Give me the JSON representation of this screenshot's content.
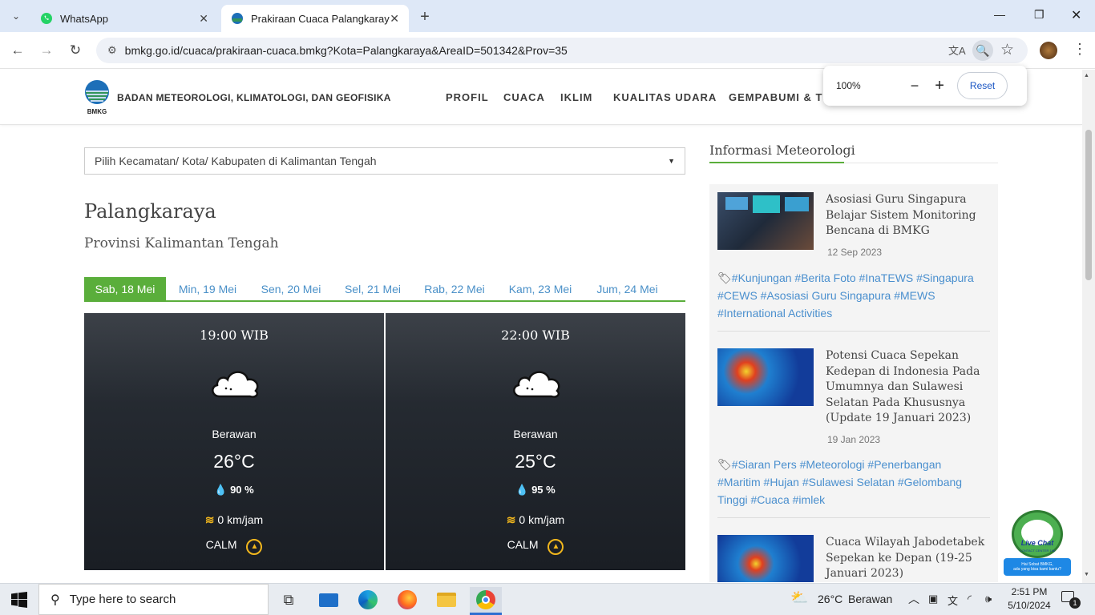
{
  "browser": {
    "tabs": [
      {
        "label": "WhatsApp"
      },
      {
        "label": "Prakiraan Cuaca Palangkaraya -"
      }
    ],
    "new_tab": "+",
    "url": "bmkg.go.id/cuaca/prakiraan-cuaca.bmkg?Kota=Palangkaraya&AreaID=501342&Prov=35",
    "zoom": {
      "level": "100%",
      "reset_label": "Reset",
      "minus": "−",
      "plus": "+"
    }
  },
  "site": {
    "logo_text": "BMKG",
    "org_name": "BADAN METEOROLOGI, KLIMATOLOGI, DAN GEOFISIKA",
    "nav": [
      "PROFIL",
      "CUACA",
      "IKLIM",
      "KUALITAS UDARA",
      "GEMPABUMI & TS"
    ]
  },
  "location_select": {
    "placeholder": "Pilih Kecamatan/ Kota/ Kabupaten di Kalimantan Tengah"
  },
  "city": "Palangkaraya",
  "province": "Provinsi Kalimantan Tengah",
  "days": [
    "Sab, 18 Mei",
    "Min, 19 Mei",
    "Sen, 20 Mei",
    "Sel, 21 Mei",
    "Rab, 22 Mei",
    "Kam, 23 Mei",
    "Jum, 24 Mei"
  ],
  "forecasts": [
    {
      "time": "19:00 WIB",
      "condition": "Berawan",
      "temp": "26°C",
      "humidity": "90 %",
      "wind": "0 km/jam",
      "direction": "CALM"
    },
    {
      "time": "22:00 WIB",
      "condition": "Berawan",
      "temp": "25°C",
      "humidity": "95 %",
      "wind": "0 km/jam",
      "direction": "CALM"
    }
  ],
  "sidebar": {
    "heading": "Informasi Meteorologi",
    "articles": [
      {
        "title_lines": [
          "Asosiasi Guru Singapura",
          "Belajar Sistem Monitoring",
          "Bencana di BMKG"
        ],
        "date": "12 Sep 2023",
        "tag_lines": [
          "#Kunjungan #Berita Foto #InaTEWS #Singapura",
          "#CEWS #Asosiasi Guru Singapura #MEWS",
          "#International Activities"
        ]
      },
      {
        "title_lines": [
          "Potensi Cuaca Sepekan",
          "Kedepan di Indonesia Pada",
          "Umumnya dan Sulawesi",
          "Selatan Pada Khususnya",
          "(Update 19 Januari 2023)"
        ],
        "date": "19 Jan 2023",
        "tag_lines": [
          "#Siaran Pers #Meteorologi #Penerbangan",
          "#Maritim #Hujan #Sulawesi Selatan #Gelombang",
          "Tinggi #Cuaca #imlek"
        ]
      },
      {
        "title_lines": [
          "Cuaca Wilayah Jabodetabek",
          "Sepekan ke Depan (19-25",
          "Januari 2023)"
        ]
      }
    ]
  },
  "livechat": {
    "title": "Live Chat",
    "subtitle": "CONTACT CENTER 196",
    "bubble_lines": [
      "Hai Sobat BMKG,",
      "ada yang bisa kami bantu?"
    ]
  },
  "taskbar": {
    "search_placeholder": "Type here to search",
    "weather": {
      "temp": "26°C",
      "condition": "Berawan"
    },
    "time": "2:51 PM",
    "date": "5/10/2024",
    "notification_count": "1"
  },
  "colors": {
    "accent_green": "#5aae3b",
    "link_blue": "#4a8fce",
    "tab_bar": "#dee8f7"
  }
}
